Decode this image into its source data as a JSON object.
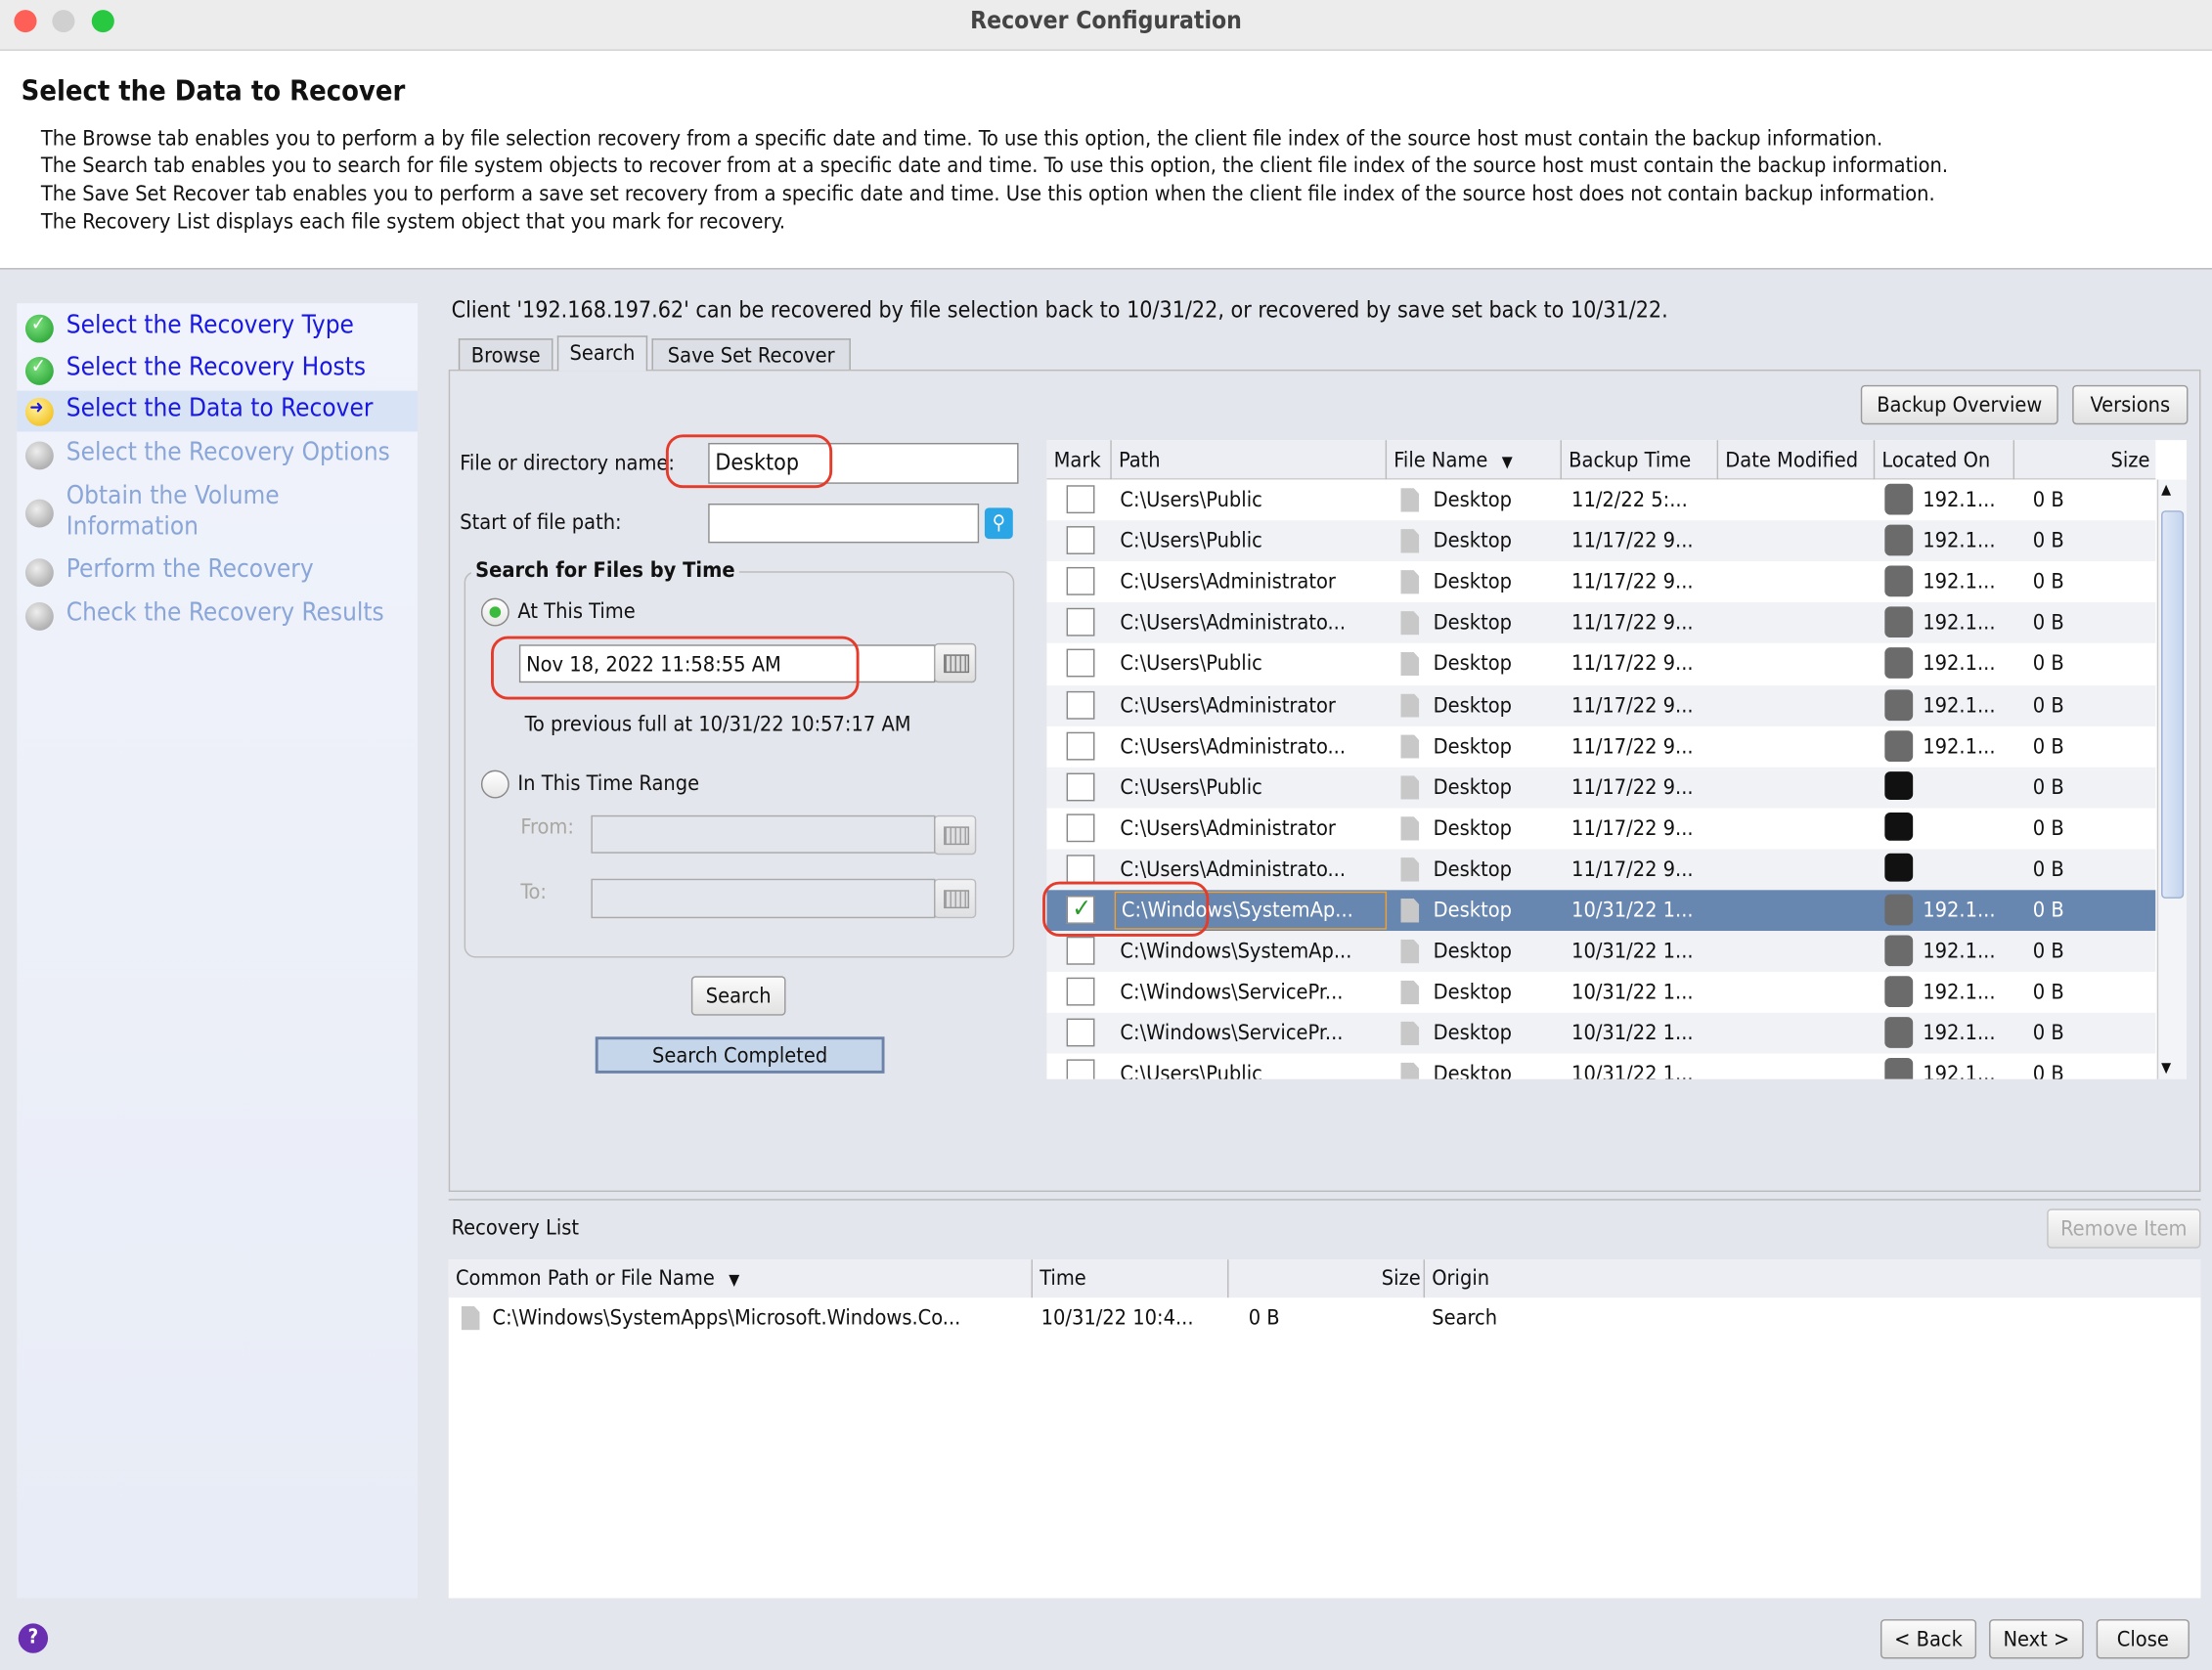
{
  "window": {
    "title": "Recover Configuration"
  },
  "header": {
    "title": "Select the Data to Recover",
    "lines": [
      "The Browse tab enables you to perform a by file selection recovery from a specific date and time. To use this option, the client file index of the source host must contain the backup information.",
      "The Search tab enables you to search for file system objects to recover from at a specific date and time. To use this option, the client file index of the source host must contain the backup information.",
      "The Save Set Recover tab enables you to perform a save set recovery from a specific date and time.  Use this option when the client file index of the source host does not contain backup information.",
      "The Recovery List displays each file system object that you mark for recovery."
    ]
  },
  "steps": [
    {
      "label": "Select the Recovery Type",
      "state": "done"
    },
    {
      "label": "Select the Recovery Hosts",
      "state": "done"
    },
    {
      "label": "Select the Data to Recover",
      "state": "current"
    },
    {
      "label": "Select the Recovery Options",
      "state": "pending"
    },
    {
      "label": "Obtain the Volume Information",
      "state": "pending"
    },
    {
      "label": "Perform the Recovery",
      "state": "pending"
    },
    {
      "label": "Check the Recovery Results",
      "state": "pending"
    }
  ],
  "client_info": "Client '192.168.197.62' can be recovered by file selection back to 10/31/22, or recovered by save set back to 10/31/22.",
  "tabs": [
    {
      "label": "Browse"
    },
    {
      "label": "Search",
      "selected": true
    },
    {
      "label": "Save Set Recover"
    }
  ],
  "toolbar": {
    "backup_overview": "Backup Overview",
    "versions": "Versions"
  },
  "search": {
    "name_label": "File or directory name:",
    "name_value": "Desktop",
    "path_label": "Start of file path:",
    "path_value": "",
    "group_title": "Search for Files by Time",
    "at_time_label": "At This Time",
    "at_time_value": "Nov 18, 2022 11:58:55 AM",
    "previous_full": "To previous full at 10/31/22 10:57:17 AM",
    "range_label": "In This Time Range",
    "from_label": "From:",
    "to_label": "To:",
    "search_button": "Search",
    "status": "Search Completed"
  },
  "results": {
    "columns": [
      "Mark",
      "Path",
      "File Name",
      "Backup Time",
      "Date Modified",
      "Located On",
      "Size"
    ],
    "rows": [
      {
        "marked": false,
        "path": "C:\\Users\\Public",
        "name": "Desktop",
        "time": "11/2/22 5:...",
        "modified": "",
        "loc": "192.1...",
        "loc_icon": "disk",
        "size": "0 B"
      },
      {
        "marked": false,
        "path": "C:\\Users\\Public",
        "name": "Desktop",
        "time": "11/17/22 9...",
        "modified": "",
        "loc": "192.1...",
        "loc_icon": "disk",
        "size": "0 B"
      },
      {
        "marked": false,
        "path": "C:\\Users\\Administrator",
        "name": "Desktop",
        "time": "11/17/22 9...",
        "modified": "",
        "loc": "192.1...",
        "loc_icon": "disk",
        "size": "0 B"
      },
      {
        "marked": false,
        "path": "C:\\Users\\Administrato...",
        "name": "Desktop",
        "time": "11/17/22 9...",
        "modified": "",
        "loc": "192.1...",
        "loc_icon": "disk",
        "size": "0 B"
      },
      {
        "marked": false,
        "path": "C:\\Users\\Public",
        "name": "Desktop",
        "time": "11/17/22 9...",
        "modified": "",
        "loc": "192.1...",
        "loc_icon": "disk",
        "size": "0 B"
      },
      {
        "marked": false,
        "path": "C:\\Users\\Administrator",
        "name": "Desktop",
        "time": "11/17/22 9...",
        "modified": "",
        "loc": "192.1...",
        "loc_icon": "disk",
        "size": "0 B"
      },
      {
        "marked": false,
        "path": "C:\\Users\\Administrato...",
        "name": "Desktop",
        "time": "11/17/22 9...",
        "modified": "",
        "loc": "192.1...",
        "loc_icon": "disk",
        "size": "0 B"
      },
      {
        "marked": false,
        "path": "C:\\Users\\Public",
        "name": "Desktop",
        "time": "11/17/22 9...",
        "modified": "",
        "loc": "",
        "loc_icon": "tape",
        "size": "0 B"
      },
      {
        "marked": false,
        "path": "C:\\Users\\Administrator",
        "name": "Desktop",
        "time": "11/17/22 9...",
        "modified": "",
        "loc": "",
        "loc_icon": "tape",
        "size": "0 B"
      },
      {
        "marked": false,
        "path": "C:\\Users\\Administrato...",
        "name": "Desktop",
        "time": "11/17/22 9...",
        "modified": "",
        "loc": "",
        "loc_icon": "tape",
        "size": "0 B"
      },
      {
        "marked": true,
        "selected": true,
        "path": "C:\\Windows\\SystemAp...",
        "name": "Desktop",
        "time": "10/31/22 1...",
        "modified": "",
        "loc": "192.1...",
        "loc_icon": "disk",
        "size": "0 B"
      },
      {
        "marked": false,
        "path": "C:\\Windows\\SystemAp...",
        "name": "Desktop",
        "time": "10/31/22 1...",
        "modified": "",
        "loc": "192.1...",
        "loc_icon": "disk",
        "size": "0 B"
      },
      {
        "marked": false,
        "path": "C:\\Windows\\ServicePr...",
        "name": "Desktop",
        "time": "10/31/22 1...",
        "modified": "",
        "loc": "192.1...",
        "loc_icon": "disk",
        "size": "0 B"
      },
      {
        "marked": false,
        "path": "C:\\Windows\\ServicePr...",
        "name": "Desktop",
        "time": "10/31/22 1...",
        "modified": "",
        "loc": "192.1...",
        "loc_icon": "disk",
        "size": "0 B"
      },
      {
        "marked": false,
        "path": "C:\\Users\\Public",
        "name": "Desktop",
        "time": "10/31/22 1...",
        "modified": "",
        "loc": "192.1...",
        "loc_icon": "disk",
        "size": "0 B"
      }
    ]
  },
  "recovery_list": {
    "title": "Recovery List",
    "remove_button": "Remove Item",
    "columns": [
      "Common Path or File Name",
      "Time",
      "Size",
      "Origin"
    ],
    "rows": [
      {
        "name": "C:\\Windows\\SystemApps\\Microsoft.Windows.Co...",
        "time": "10/31/22 10:4...",
        "size": "0 B",
        "origin": "Search"
      }
    ]
  },
  "footer": {
    "back": "< Back",
    "next": "Next >",
    "close": "Close",
    "help_icon": "question-icon"
  },
  "colors": {
    "link": "#1818e0",
    "selection": "#6786b0",
    "annotation": "#e53b2b"
  }
}
